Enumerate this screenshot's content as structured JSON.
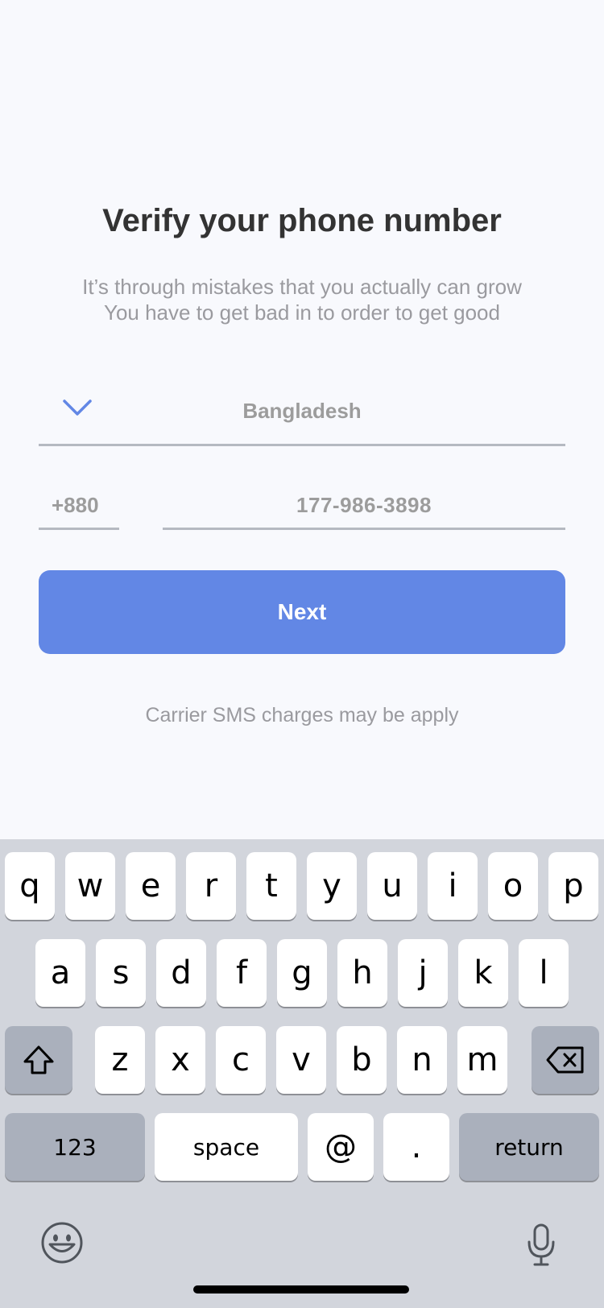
{
  "header": {
    "title": "Verify your phone number",
    "subtitle_line1": "It’s through mistakes that you actually can grow",
    "subtitle_line2": "You have to get bad in to order to get good"
  },
  "form": {
    "country": "Bangladesh",
    "country_code": "+880",
    "phone_number": "177-986-3898",
    "next_label": "Next",
    "note": "Carrier SMS charges may be apply"
  },
  "keyboard": {
    "row1": [
      "q",
      "w",
      "e",
      "r",
      "t",
      "y",
      "u",
      "i",
      "o",
      "p"
    ],
    "row2": [
      "a",
      "s",
      "d",
      "f",
      "g",
      "h",
      "j",
      "k",
      "l"
    ],
    "row3": [
      "z",
      "x",
      "c",
      "v",
      "b",
      "n",
      "m"
    ],
    "numbers_label": "123",
    "space_label": "space",
    "at_label": "@",
    "dot_label": ".",
    "return_label": "return",
    "icons": {
      "shift": "shift-icon",
      "delete": "backspace-icon",
      "emoji": "emoji-icon",
      "dictation": "microphone-icon"
    }
  },
  "colors": {
    "accent": "#6287e5",
    "background": "#f8f9fd",
    "keyboard_bg": "#d2d5dc"
  }
}
